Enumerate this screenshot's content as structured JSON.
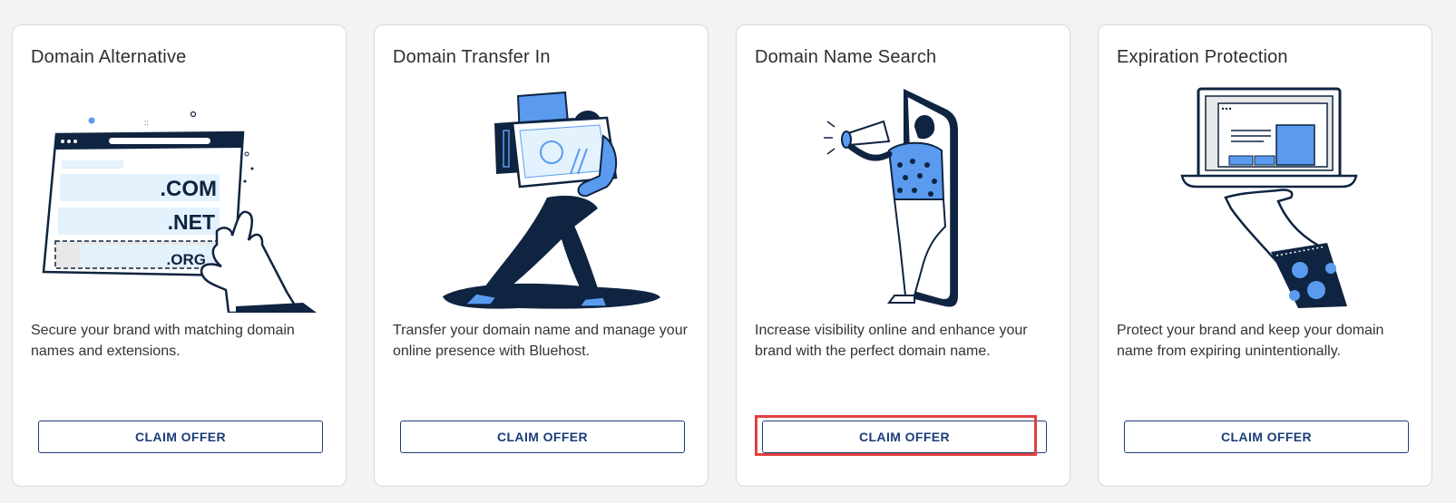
{
  "cards": [
    {
      "title": "Domain Alternative",
      "description": "Secure your brand with matching domain names and extensions.",
      "button_label": "CLAIM OFFER",
      "illustration": "domain-extensions-illustration",
      "extensions": [
        ".COM",
        ".NET",
        ".ORG"
      ]
    },
    {
      "title": "Domain Transfer In",
      "description": "Transfer your domain name and manage your online presence with Bluehost.",
      "button_label": "CLAIM OFFER",
      "illustration": "person-carrying-boxes-illustration"
    },
    {
      "title": "Domain Name Search",
      "description": "Increase visibility online and enhance your brand with the perfect domain name.",
      "button_label": "CLAIM OFFER",
      "illustration": "person-megaphone-phone-illustration",
      "highlighted": true
    },
    {
      "title": "Expiration Protection",
      "description": "Protect your brand and keep your domain name from expiring unintentionally.",
      "button_label": "CLAIM OFFER",
      "illustration": "hand-holding-laptop-illustration"
    }
  ],
  "colors": {
    "navy": "#0f2440",
    "accent_blue": "#5a9bf0",
    "light_blue": "#e3f2fd",
    "button_text": "#1c3c7a",
    "highlight": "#e04040"
  }
}
